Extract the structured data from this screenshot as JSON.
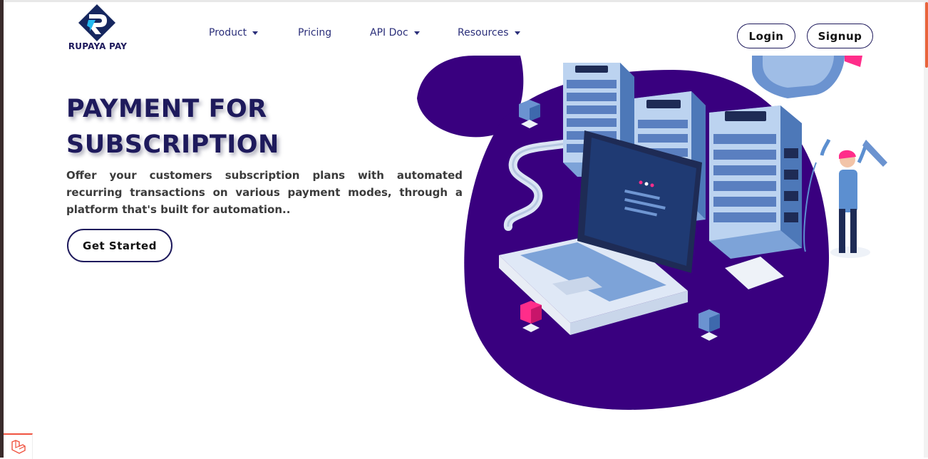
{
  "brand": {
    "name": "RUPAYA PAY"
  },
  "nav": {
    "items": [
      {
        "label": "Product",
        "has_dropdown": true
      },
      {
        "label": "Pricing",
        "has_dropdown": false
      },
      {
        "label": "API Doc",
        "has_dropdown": true
      },
      {
        "label": "Resources",
        "has_dropdown": true
      }
    ],
    "login_label": "Login",
    "signup_label": "Signup"
  },
  "hero": {
    "title_line1": "PAYMENT FOR",
    "title_line2": "SUBSCRIPTION",
    "description": "Offer your customers subscription plans with automated recurring transactions on various payment modes, through a platform that's built for automation..",
    "cta_label": "Get Started"
  },
  "colors": {
    "brand_navy": "#1e1a5c",
    "nav_text": "#2b2f7a",
    "blob_purple": "#39007f",
    "accent_pink": "#ff2d8a",
    "server_blue": "#5c8fd0"
  },
  "icons": {
    "logo": "rupaya-pay-logo",
    "dropdown": "caret-down-icon",
    "illustration": "server-laptop-illustration",
    "debug_badge": "laravel-icon"
  }
}
